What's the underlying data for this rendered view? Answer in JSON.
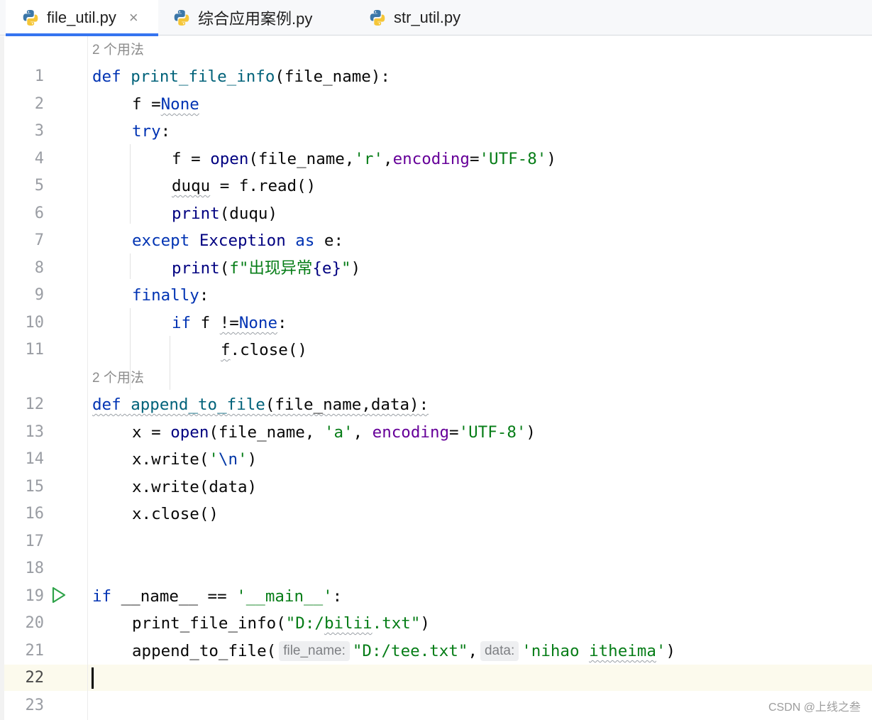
{
  "tabs": [
    {
      "label": "file_util.py",
      "close": "×"
    },
    {
      "label": "综合应用案例.py"
    },
    {
      "label": "str_util.py"
    }
  ],
  "usage_hints": [
    "2 个用法",
    "2 个用法"
  ],
  "line_numbers": [
    "1",
    "2",
    "3",
    "4",
    "5",
    "6",
    "7",
    "8",
    "9",
    "10",
    "11",
    "12",
    "13",
    "14",
    "15",
    "16",
    "17",
    "18",
    "19",
    "20",
    "21",
    "22",
    "23"
  ],
  "code": {
    "l1": {
      "kw": "def",
      "fn": "print_file_info",
      "rest": "(file_name):"
    },
    "l2": {
      "a": "f =",
      "b": "None"
    },
    "l3": {
      "kw": "try",
      "rest": ":"
    },
    "l4": {
      "a": "f = ",
      "b": "open",
      "c": "(file_name,",
      "d": "'r'",
      "e": ",",
      "f": "encoding",
      "g": "=",
      "h": "'UTF-8'",
      "i": ")"
    },
    "l5": {
      "a": "duqu",
      "b": " = f.read()"
    },
    "l6": {
      "a": "print",
      "b": "(duqu)"
    },
    "l7": {
      "kw": "except",
      "a": " Exception ",
      "b": "as",
      "c": " e:"
    },
    "l8": {
      "a": "print",
      "b": "(",
      "c": "f\"出现异常",
      "d": "{e}",
      "e": "\"",
      "f": ")"
    },
    "l9": {
      "kw": "finally",
      "rest": ":"
    },
    "l10": {
      "kw": "if",
      "a": " f ",
      "b": "!=",
      "c": "None",
      "d": ":"
    },
    "l11": {
      "a": "f",
      "b": ".close()"
    },
    "l12": {
      "kw": "def",
      "fn": "append_to_file",
      "rest": "(file_name,data):"
    },
    "l13": {
      "a": "x = ",
      "b": "open",
      "c": "(file_name, ",
      "d": "'a'",
      "e": ", ",
      "f": "encoding",
      "g": "=",
      "h": "'UTF-8'",
      "i": ")"
    },
    "l14": {
      "a": "x.write(",
      "b": "'",
      "c": "\\n",
      "d": "'",
      "e": ")"
    },
    "l15": {
      "a": "x.write(data)"
    },
    "l16": {
      "a": "x.close()"
    },
    "l19": {
      "kw": "if",
      "a": " __name__ == ",
      "b": "'__main__'",
      "c": ":"
    },
    "l20": {
      "a": "print_file_info(",
      "b": "\"D:/",
      "c": "bilii",
      "d": ".txt\"",
      "e": ")"
    },
    "l21": {
      "a": "append_to_file(",
      "hint1": "file_name:",
      "b": "\"D:/tee.txt\"",
      "c": ",",
      "hint2": "data:",
      "d": "'nihao ",
      "e": "itheima",
      "f": "'",
      "g": ")"
    }
  },
  "watermark": "CSDN @上线之叁",
  "colors": {
    "keyword": "#0033b3",
    "function": "#00627a",
    "string": "#067d17",
    "kwarg": "#660099",
    "accent": "#3574f0"
  },
  "icons": [
    "python-file-icon",
    "close-icon",
    "run-icon"
  ]
}
